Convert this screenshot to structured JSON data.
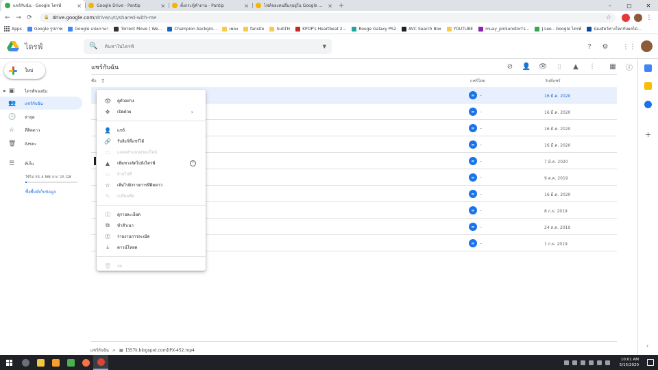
{
  "browser": {
    "tabs": [
      {
        "title": "แชร์กับฉัน - Google ไดรฟ์",
        "active": true,
        "favicon_color": "#34a853"
      },
      {
        "title": "Google Drive - Pantip",
        "active": false,
        "favicon_color": "#f4b400"
      },
      {
        "title": "ตั้งกระทู้คำถาม - Pantip",
        "active": false,
        "favicon_color": "#f4b400"
      },
      {
        "title": "ไฟล์ของคนอื่นๆอยู่ใน Google Drive",
        "active": false,
        "favicon_color": "#f4b400"
      }
    ],
    "new_tab_symbol": "+",
    "url_host": "drive.google.com",
    "url_path": "/drive/u/0/shared-with-me",
    "bookmarks": [
      {
        "label": "Apps",
        "color": "#5f6368"
      },
      {
        "label": "Google รูปภาพ",
        "color": "#4285f4"
      },
      {
        "label": "Google แปลภาษา",
        "color": "#4285f4"
      },
      {
        "label": "Torrent Move ( We...",
        "color": "#333333"
      },
      {
        "label": "Champion backgro...",
        "color": "#1565c0"
      },
      {
        "label": "เพลง",
        "color": "#f7cb4d"
      },
      {
        "label": "fansite",
        "color": "#f7cb4d"
      },
      {
        "label": "SubTH",
        "color": "#f7cb4d"
      },
      {
        "label": "KPOP's Heartbeat 2...",
        "color": "#c62828"
      },
      {
        "label": "Rouge Galaxy PS2",
        "color": "#26a69a"
      },
      {
        "label": "AVC Search Box",
        "color": "#212121"
      },
      {
        "label": "YOUTUBE",
        "color": "#f7cb4d"
      },
      {
        "label": "muay_pinkunotori's...",
        "color": "#8e24aa"
      },
      {
        "label": "J.Lee - Google ไดรฟ์",
        "color": "#34a853"
      },
      {
        "label": "น้องสัตว์ทางโลกกับผลไม้...",
        "color": "#0d47a1"
      }
    ]
  },
  "drive": {
    "app_name": "ไดรฟ์",
    "search_placeholder": "ค้นหาในไดรฟ์",
    "new_button": "ใหม่",
    "nav": [
      {
        "label": "ไดรฟ์ของฉัน",
        "icon": "my-drive-icon",
        "glyph": "▣",
        "active": false
      },
      {
        "label": "แชร์กับฉัน",
        "icon": "shared-icon",
        "glyph": "👥",
        "active": true
      },
      {
        "label": "ล่าสุด",
        "icon": "recent-icon",
        "glyph": "🕓",
        "active": false
      },
      {
        "label": "ที่ติดดาว",
        "icon": "star-icon",
        "glyph": "☆",
        "active": false
      },
      {
        "label": "ถังขยะ",
        "icon": "trash-icon",
        "glyph": "🗑",
        "active": false
      }
    ],
    "storage": {
      "label": "ที่เก็บ",
      "usage_text": "ใช้ไป 55.4 MB จาก 15 GB",
      "used_fraction": 0.0036,
      "buy_link": "ซื้อพื้นที่เก็บข้อมูล"
    },
    "page_title": "แชร์กับฉัน",
    "columns": {
      "name": "ชื่อ",
      "sort_arrow": "↑",
      "shared_by": "แชร์โดย",
      "share_date": "วันที่แชร์"
    },
    "rows": [
      {
        "owner_dash": "–",
        "date": "16 มี.ค. 2020",
        "selected": true
      },
      {
        "owner_dash": "–",
        "date": "16 มี.ค. 2020",
        "selected": false
      },
      {
        "owner_dash": "–",
        "date": "16 มี.ค. 2020",
        "selected": false
      },
      {
        "owner_dash": "–",
        "date": "16 มี.ค. 2020",
        "selected": false
      },
      {
        "owner_dash": "–",
        "date": "7 มี.ค. 2020",
        "selected": false
      },
      {
        "owner_dash": "–",
        "date": "9 ต.ค. 2019",
        "selected": false
      },
      {
        "owner_dash": "–",
        "date": "16 มี.ค. 2020",
        "selected": false
      },
      {
        "owner_dash": "–",
        "date": "8 ก.ย. 2019",
        "selected": false
      },
      {
        "owner_dash": "–",
        "date": "24 ส.ค. 2019",
        "selected": false
      },
      {
        "owner_dash": "–",
        "date": "1 ก.ย. 2019",
        "selected": false
      }
    ],
    "context_menu": [
      {
        "label": "ดูตัวอย่าง",
        "icon": "preview-eye-icon",
        "glyph": "👁",
        "disabled": false
      },
      {
        "label": "เปิดด้วย",
        "icon": "open-with-icon",
        "glyph": "✥",
        "disabled": false,
        "submenu": "›"
      },
      {
        "sep": true
      },
      {
        "label": "แชร์",
        "icon": "share-person-icon",
        "glyph": "👤",
        "disabled": false
      },
      {
        "label": "รับลิงก์ที่แชร์ได้",
        "icon": "link-icon",
        "glyph": "🔗",
        "disabled": false
      },
      {
        "label": "แสดงตำแหน่งของไฟล์",
        "icon": "folder-icon",
        "glyph": "▭",
        "disabled": true
      },
      {
        "label": "เพิ่มทางลัดไปยังไดรฟ์",
        "icon": "drive-shortcut-icon",
        "glyph": "▲",
        "disabled": false,
        "help": "?"
      },
      {
        "label": "ย้ายไปที่",
        "icon": "move-to-icon",
        "glyph": "▭",
        "disabled": true
      },
      {
        "label": "เพิ่มไปยังรายการที่ติดดาว",
        "icon": "star-add-icon",
        "glyph": "☆",
        "disabled": false
      },
      {
        "label": "เปลี่ยนชื่อ",
        "icon": "rename-pencil-icon",
        "glyph": "✎",
        "disabled": true
      },
      {
        "sep": true
      },
      {
        "label": "ดูรายละเอียด",
        "icon": "details-info-icon",
        "glyph": "ⓘ",
        "disabled": false
      },
      {
        "label": "ทำสำเนา",
        "icon": "copy-icon",
        "glyph": "⧉",
        "disabled": false
      },
      {
        "label": "รายงานการละเมิด",
        "icon": "report-icon",
        "glyph": "⓵",
        "disabled": false
      },
      {
        "label": "ดาวน์โหลด",
        "icon": "download-icon",
        "glyph": "⤓",
        "disabled": false
      },
      {
        "sep": true
      },
      {
        "label": "ลบ",
        "icon": "trash-icon",
        "glyph": "🗑",
        "disabled": true
      }
    ],
    "breadcrumb": {
      "root": "แชร์กับฉัน",
      "separator": ">",
      "file": "[357k.blogspot.com]IPX-452.mp4"
    }
  },
  "taskbar": {
    "time": "10:01 AM",
    "date": "5/15/2020",
    "apps": [
      "#f2c744",
      "#f7a02a",
      "#4caf50",
      "#ff7043",
      "#db4437"
    ]
  }
}
